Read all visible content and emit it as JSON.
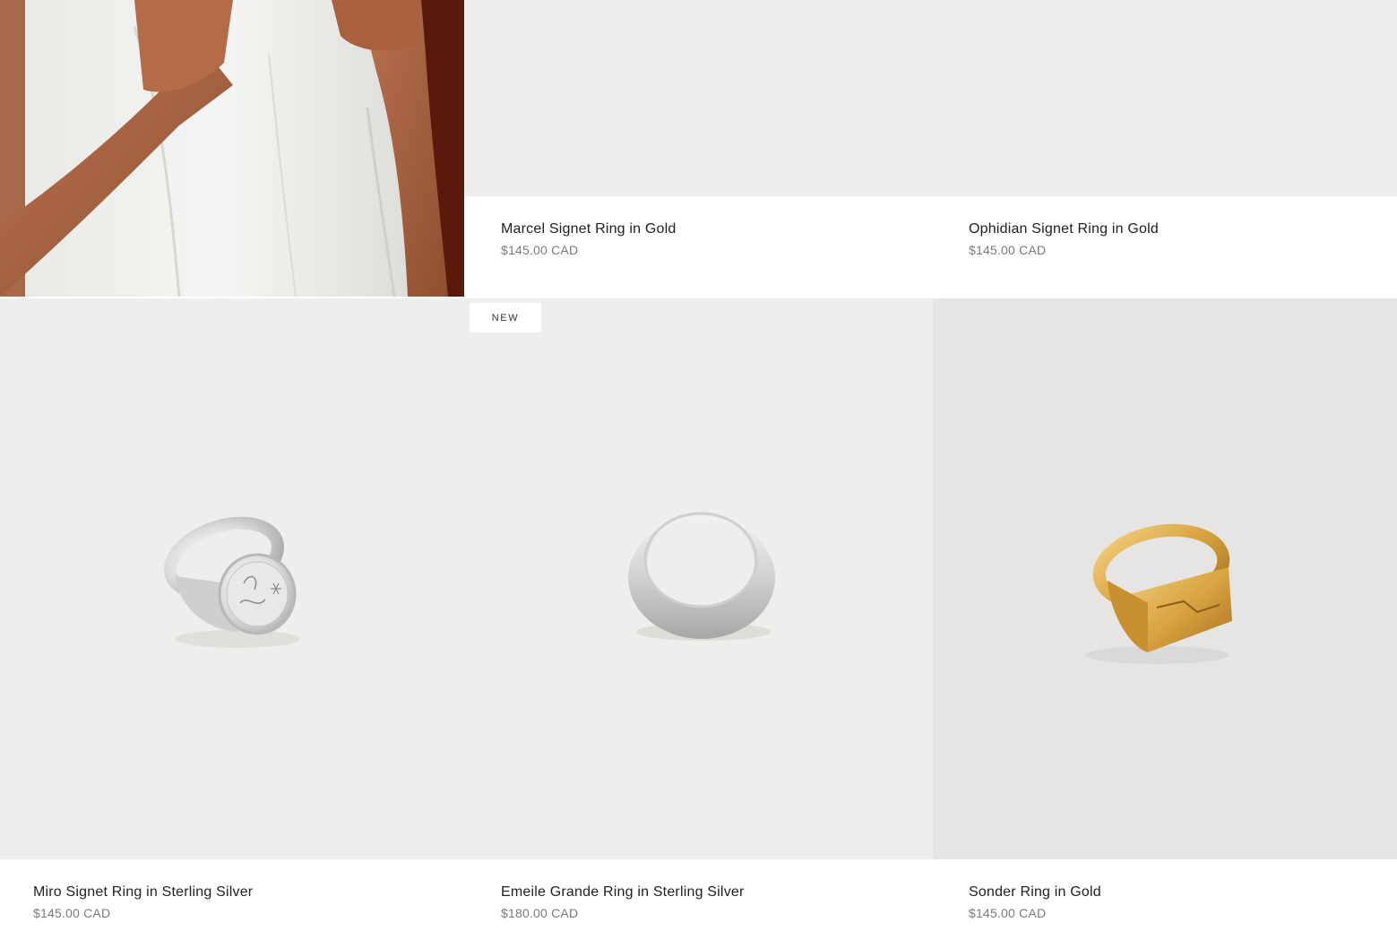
{
  "products": [
    {
      "title": "Marcel Signet Ring in Gold",
      "price": "$145.00 CAD"
    },
    {
      "title": "Ophidian Signet Ring in Gold",
      "price": "$145.00 CAD"
    },
    {
      "title": "Miro Signet Ring in Sterling Silver",
      "price": "$145.00 CAD"
    },
    {
      "title": "Emeile Grande Ring in Sterling Silver",
      "price": "$180.00 CAD",
      "badge": "NEW"
    },
    {
      "title": "Sonder Ring in Gold",
      "price": "$145.00 CAD"
    }
  ],
  "colors": {
    "tile_bg": "#efeeec",
    "tile_bg_sonder": "#e6e5e3",
    "title_text": "#1f1f1f",
    "price_text": "#7a7a7a",
    "gold": "#d9a441",
    "silver": "#d6d6d6"
  },
  "icons": [
    "signet-ring-silver-image",
    "dome-ring-silver-image",
    "signet-ring-gold-image",
    "model-hands-image"
  ]
}
